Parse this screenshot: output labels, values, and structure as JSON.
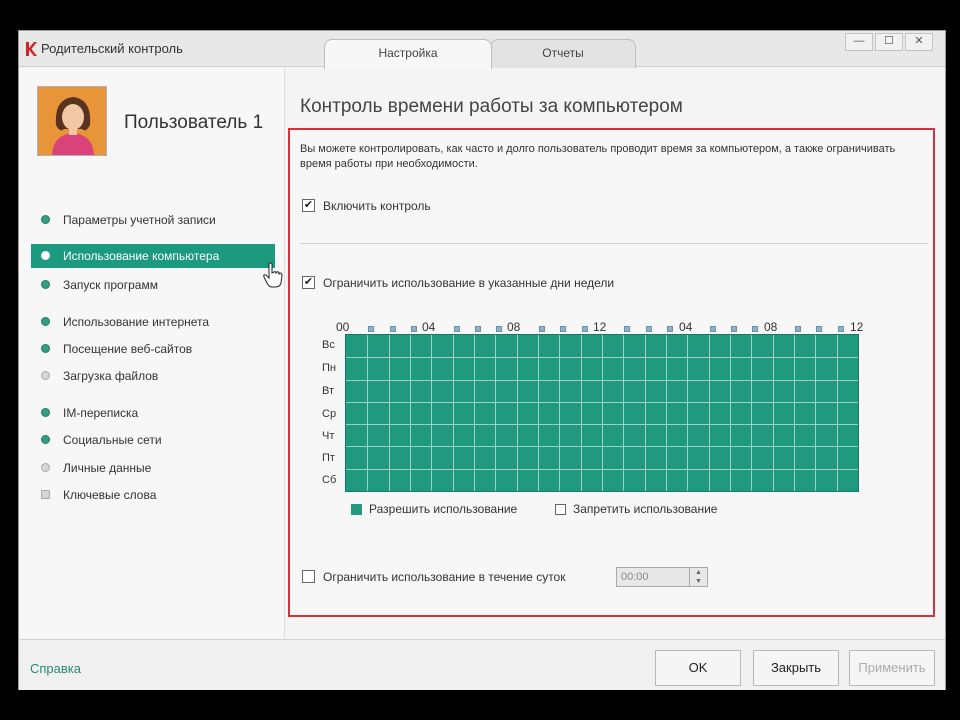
{
  "window": {
    "app_title": "Родительский контроль",
    "tabs": [
      {
        "label": "Настройка",
        "active": true
      },
      {
        "label": "Отчеты",
        "active": false
      }
    ],
    "controls": {
      "minimize": "—",
      "maximize": "☐",
      "close": "✕"
    }
  },
  "sidebar": {
    "user_name": "Пользователь 1",
    "items": [
      {
        "label": "Параметры учетной записи",
        "state": "on"
      },
      {
        "label": "Использование компьютера",
        "state": "on",
        "active": true
      },
      {
        "label": "Запуск программ",
        "state": "on"
      },
      {
        "label": "Использование интернета",
        "state": "on"
      },
      {
        "label": "Посещение веб-сайтов",
        "state": "on"
      },
      {
        "label": "Загрузка файлов",
        "state": "off"
      },
      {
        "label": "IM-переписка",
        "state": "on"
      },
      {
        "label": "Социальные сети",
        "state": "on"
      },
      {
        "label": "Личные данные",
        "state": "off"
      },
      {
        "label": "Ключевые слова",
        "state": "off"
      }
    ]
  },
  "main": {
    "title": "Контроль времени работы за компьютером",
    "description": "Вы можете контролировать, как часто и долго пользователь проводит время за компьютером, а также ограничивать время работы при необходимости.",
    "enable_control": {
      "label": "Включить контроль",
      "checked": true
    },
    "limit_days": {
      "label": "Ограничить использование в указанные дни недели",
      "checked": true
    },
    "hour_labels": [
      "00",
      "04",
      "08",
      "12",
      "04",
      "08",
      "12"
    ],
    "days": [
      "Вс",
      "Пн",
      "Вт",
      "Ср",
      "Чт",
      "Пт",
      "Сб"
    ],
    "legend": {
      "allow": "Разрешить использование",
      "deny": "Запретить использование",
      "allow_color": "#1f9a7f"
    },
    "limit_daily": {
      "label": "Ограничить использование в течение суток",
      "checked": false,
      "value": "00:00"
    }
  },
  "footer": {
    "help": "Справка",
    "ok": "OK",
    "close": "Закрыть",
    "apply": "Применить"
  }
}
